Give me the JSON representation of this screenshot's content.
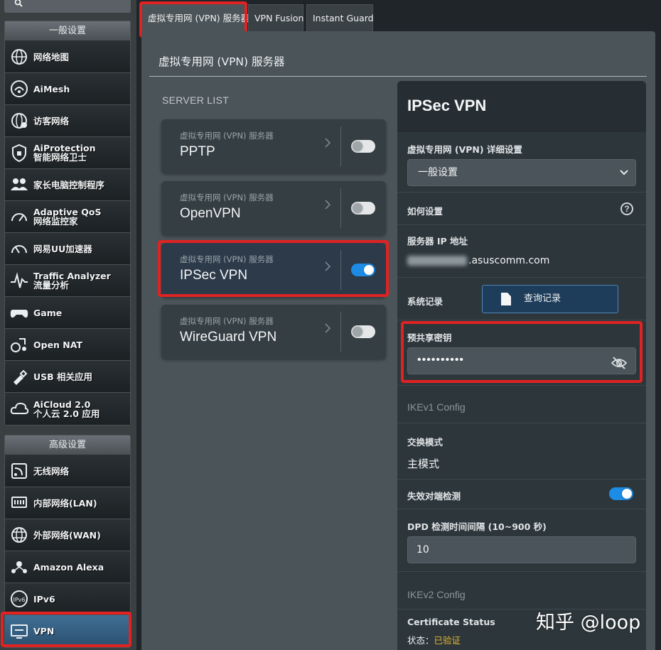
{
  "sidebar": {
    "general_header": "一般设置",
    "advanced_header": "高级设置",
    "general_items": [
      {
        "name": "network-map",
        "l1": "网络地图",
        "l2": ""
      },
      {
        "name": "aimesh",
        "l1": "AiMesh",
        "l2": ""
      },
      {
        "name": "guest-network",
        "l1": "访客网络",
        "l2": ""
      },
      {
        "name": "aiprotection",
        "l1": "AiProtection",
        "l2": "智能网络卫士"
      },
      {
        "name": "parental-controls",
        "l1": "家长电脑控制程序",
        "l2": ""
      },
      {
        "name": "adaptive-qos",
        "l1": "Adaptive QoS",
        "l2": "网络监控家"
      },
      {
        "name": "uu-accelerator",
        "l1": "网易UU加速器",
        "l2": ""
      },
      {
        "name": "traffic-analyzer",
        "l1": "Traffic Analyzer",
        "l2": "流量分析"
      },
      {
        "name": "game",
        "l1": "Game",
        "l2": ""
      },
      {
        "name": "open-nat",
        "l1": "Open NAT",
        "l2": ""
      },
      {
        "name": "usb-apps",
        "l1": "USB 相关应用",
        "l2": ""
      },
      {
        "name": "aicloud",
        "l1": "AiCloud 2.0",
        "l2": "个人云 2.0 应用"
      }
    ],
    "advanced_items": [
      {
        "name": "wireless",
        "l1": "无线网络",
        "l2": ""
      },
      {
        "name": "lan",
        "l1": "内部网络(LAN)",
        "l2": ""
      },
      {
        "name": "wan",
        "l1": "外部网络(WAN)",
        "l2": ""
      },
      {
        "name": "amazon-alexa",
        "l1": "Amazon Alexa",
        "l2": ""
      },
      {
        "name": "ipv6",
        "l1": "IPv6",
        "l2": ""
      },
      {
        "name": "vpn",
        "l1": "VPN",
        "l2": ""
      }
    ]
  },
  "tabs": [
    {
      "label": "虚拟专用网 (VPN) 服务器",
      "active": true
    },
    {
      "label": "VPN Fusion",
      "active": false
    },
    {
      "label": "Instant Guard",
      "active": false
    }
  ],
  "main": {
    "title": "虚拟专用网 (VPN) 服务器",
    "server_list_title": "SERVER LIST",
    "servers": [
      {
        "sub": "虚拟专用网 (VPN) 服务器",
        "name": "PPTP",
        "enabled": false
      },
      {
        "sub": "虚拟专用网 (VPN) 服务器",
        "name": "OpenVPN",
        "enabled": false
      },
      {
        "sub": "虚拟专用网 (VPN) 服务器",
        "name": "IPSec VPN",
        "enabled": true
      },
      {
        "sub": "虚拟专用网 (VPN) 服务器",
        "name": "WireGuard VPN",
        "enabled": false
      }
    ]
  },
  "detail": {
    "title": "IPSec VPN",
    "details_label": "虚拟专用网 (VPN) 详细设置",
    "details_select": "一般设置",
    "how_to_label": "如何设置",
    "server_ip_label": "服务器 IP 地址",
    "server_ip_suffix": ".asuscomm.com",
    "syslog_label": "系统记录",
    "syslog_button": "查询记录",
    "psk_label": "预共享密钥",
    "psk_value": "••••••••••",
    "ikev1_label": "IKEv1 Config",
    "exchange_mode_label": "交换模式",
    "exchange_mode_value": "主模式",
    "dpd_label": "失效对端检测",
    "dpd_interval_label": "DPD 检测时间间隔 (10~900 秒)",
    "dpd_interval_value": "10",
    "ikev2_label": "IKEv2 Config",
    "cert_status_label": "Certificate Status",
    "status_prefix": "状态：",
    "status_value": "已验证"
  },
  "watermark": "知乎 @loop",
  "colors": {
    "accent": "#1c8ce6",
    "highlight": "#e02222",
    "verified": "#e8b830"
  }
}
